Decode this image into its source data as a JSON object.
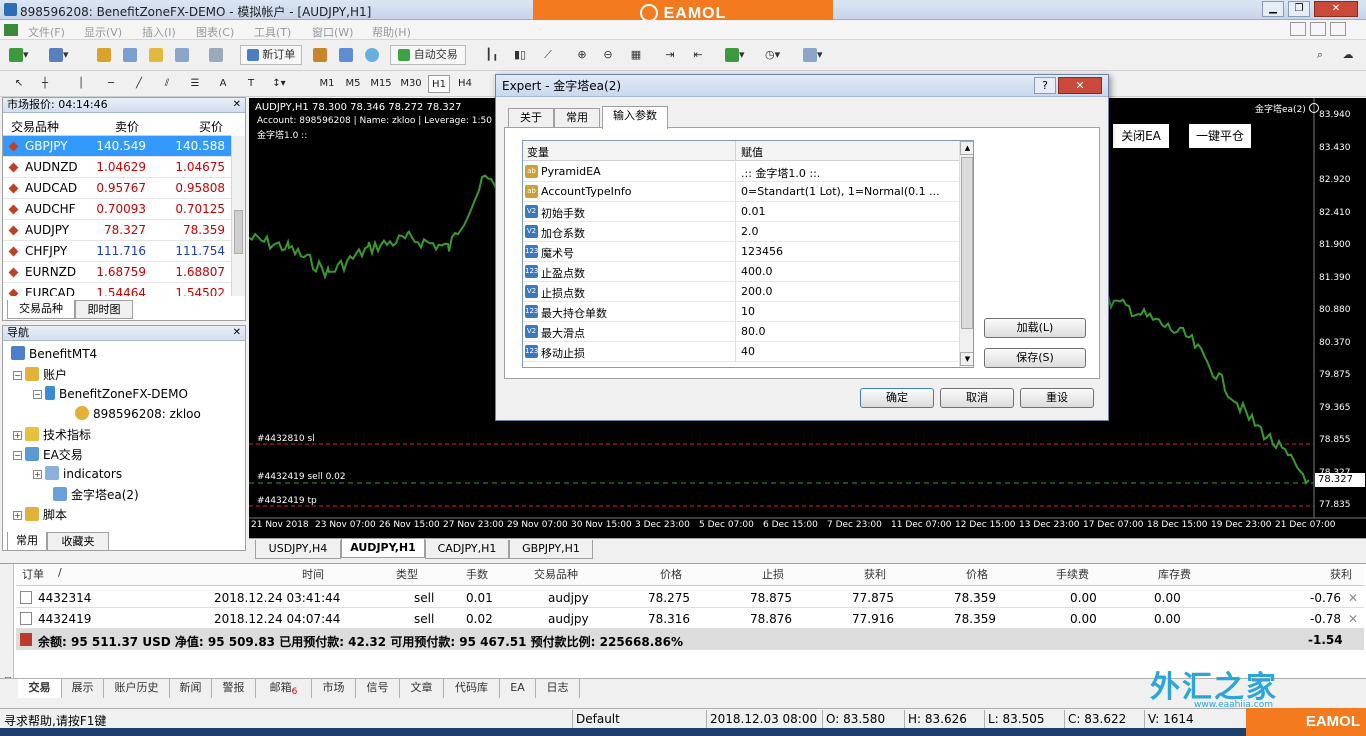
{
  "window": {
    "title": "898596208: BenefitZoneFX-DEMO - 模拟帐户 - [AUDJPY,H1]",
    "brand_logo": "EAMOL",
    "accent": "#f47a20"
  },
  "menu": [
    "文件(F)",
    "显示(V)",
    "插入(I)",
    "图表(C)",
    "工具(T)",
    "窗口(W)",
    "帮助(H)"
  ],
  "toolbar": {
    "new_order": "新订单",
    "auto_trading": "自动交易"
  },
  "timeframes": [
    "M1",
    "M5",
    "M15",
    "M30",
    "H1",
    "H4"
  ],
  "market_watch": {
    "title": "市场报价: 04:14:46",
    "columns": [
      "交易品种",
      "卖价",
      "买价"
    ],
    "rows": [
      {
        "symbol": "GBPJPY",
        "bid": "140.549",
        "ask": "140.588"
      },
      {
        "symbol": "AUDNZD",
        "bid": "1.04629",
        "ask": "1.04675"
      },
      {
        "symbol": "AUDCAD",
        "bid": "0.95767",
        "ask": "0.95808"
      },
      {
        "symbol": "AUDCHF",
        "bid": "0.70093",
        "ask": "0.70125"
      },
      {
        "symbol": "AUDJPY",
        "bid": "78.327",
        "ask": "78.359"
      },
      {
        "symbol": "CHFJPY",
        "bid": "111.716",
        "ask": "111.754"
      },
      {
        "symbol": "EURNZD",
        "bid": "1.68759",
        "ask": "1.68807"
      },
      {
        "symbol": "EURCAD",
        "bid": "1.54464",
        "ask": "1.54502"
      }
    ],
    "tabs": [
      "交易品种",
      "即时图"
    ]
  },
  "navigator": {
    "title": "导航",
    "root": "BenefitMT4",
    "accounts": "账户",
    "server": "BenefitZoneFX-DEMO",
    "account": "898596208: zkloo",
    "indicators_folder": "技术指标",
    "ea_folder": "EA交易",
    "indicators": "indicators",
    "ea": "金字塔ea(2)",
    "scripts": "脚本",
    "tabs": [
      "常用",
      "收藏夹"
    ]
  },
  "chart": {
    "header": "AUDJPY,H1  78.300 78.346 78.272 78.327",
    "account_line": "Account: 898596208 | Name: zkloo | Leverage: 1:50 | To",
    "ea_label": "金字塔1.0 ::",
    "ea_corner": "金字塔ea(2)",
    "close_ea": "关闭EA",
    "close_all": "一键平仓",
    "current_price": "78.327",
    "price_labels": [
      "83.940",
      "83.430",
      "82.920",
      "82.410",
      "81.900",
      "81.390",
      "80.880",
      "80.370",
      "79.875",
      "79.365",
      "78.855",
      "78.327",
      "77.835"
    ],
    "time_labels": [
      "21 Nov 2018",
      "23 Nov 07:00",
      "26 Nov 15:00",
      "27 Nov 23:00",
      "29 Nov 07:00",
      "30 Nov 15:00",
      "3 Dec 23:00",
      "5 Dec 07:00",
      "6 Dec 15:00",
      "7 Dec 23:00",
      "11 Dec 07:00",
      "12 Dec 15:00",
      "13 Dec 23:00",
      "17 Dec 07:00",
      "18 Dec 15:00",
      "19 Dec 23:00",
      "21 Dec 07:00"
    ],
    "order_lines": [
      "#4432810 sl",
      "#4432419 sell 0.02",
      "#4432419 tp"
    ],
    "tabs": [
      "USDJPY,H4",
      "AUDJPY,H1",
      "CADJPY,H1",
      "GBPJPY,H1"
    ],
    "active_tab": 1
  },
  "dialog": {
    "title": "Expert - 金字塔ea(2)",
    "tabs": [
      "关于",
      "常用",
      "输入参数"
    ],
    "columns": [
      "变量",
      "赋值"
    ],
    "params": [
      {
        "type": "ab",
        "name": "PyramidEA",
        "value": ".:: 金字塔1.0 ::."
      },
      {
        "type": "ab",
        "name": "AccountTypeInfo",
        "value": "0=Standart(1 Lot), 1=Normal(0.1 ..."
      },
      {
        "type": "V2",
        "name": "初始手数",
        "value": "0.01"
      },
      {
        "type": "V2",
        "name": "加仓系数",
        "value": "2.0"
      },
      {
        "type": "123",
        "name": "魔术号",
        "value": "123456"
      },
      {
        "type": "123",
        "name": "止盈点数",
        "value": "400.0"
      },
      {
        "type": "V2",
        "name": "止损点数",
        "value": "200.0"
      },
      {
        "type": "123",
        "name": "最大持仓单数",
        "value": "10"
      },
      {
        "type": "V2",
        "name": "最大滑点",
        "value": "80.0"
      },
      {
        "type": "123",
        "name": "移动止损",
        "value": "40"
      }
    ],
    "load": "加载(L)",
    "save": "保存(S)",
    "ok": "确定",
    "cancel": "取消",
    "reset": "重设"
  },
  "terminal": {
    "columns": [
      "订单",
      "/",
      "时间",
      "类型",
      "手数",
      "交易品种",
      "价格",
      "止损",
      "获利",
      "价格",
      "手续费",
      "库存费",
      "获利"
    ],
    "orders": [
      {
        "id": "4432314",
        "time": "2018.12.24 03:41:44",
        "type": "sell",
        "lots": "0.01",
        "symbol": "audjpy",
        "price": "78.275",
        "sl": "78.875",
        "tp": "77.875",
        "cur": "78.359",
        "comm": "0.00",
        "swap": "0.00",
        "profit": "-0.76"
      },
      {
        "id": "4432419",
        "time": "2018.12.24 04:07:44",
        "type": "sell",
        "lots": "0.02",
        "symbol": "audjpy",
        "price": "78.316",
        "sl": "78.876",
        "tp": "77.916",
        "cur": "78.359",
        "comm": "0.00",
        "swap": "0.00",
        "profit": "-0.78"
      }
    ],
    "summary": "余额: 95 511.37 USD  净值: 95 509.83  已用预付款: 42.32  可用预付款: 95 467.51  预付款比例: 225668.86%",
    "total": "-1.54",
    "tabs": [
      "交易",
      "展示",
      "账户历史",
      "新闻",
      "警报",
      "邮箱",
      "市场",
      "信号",
      "文章",
      "代码库",
      "EA",
      "日志"
    ],
    "mail_badge": "6"
  },
  "watermark": {
    "name": "外汇之家",
    "url": "www.eaahiia.com",
    "logo": "EAMOL"
  },
  "status": {
    "help": "寻求帮助,请按F1键",
    "profile": "Default",
    "datetime": "2018.12.03 08:00",
    "open": "O: 83.580",
    "high": "H: 83.626",
    "low": "L: 83.505",
    "close": "C: 83.622",
    "volume": "V: 1614"
  }
}
